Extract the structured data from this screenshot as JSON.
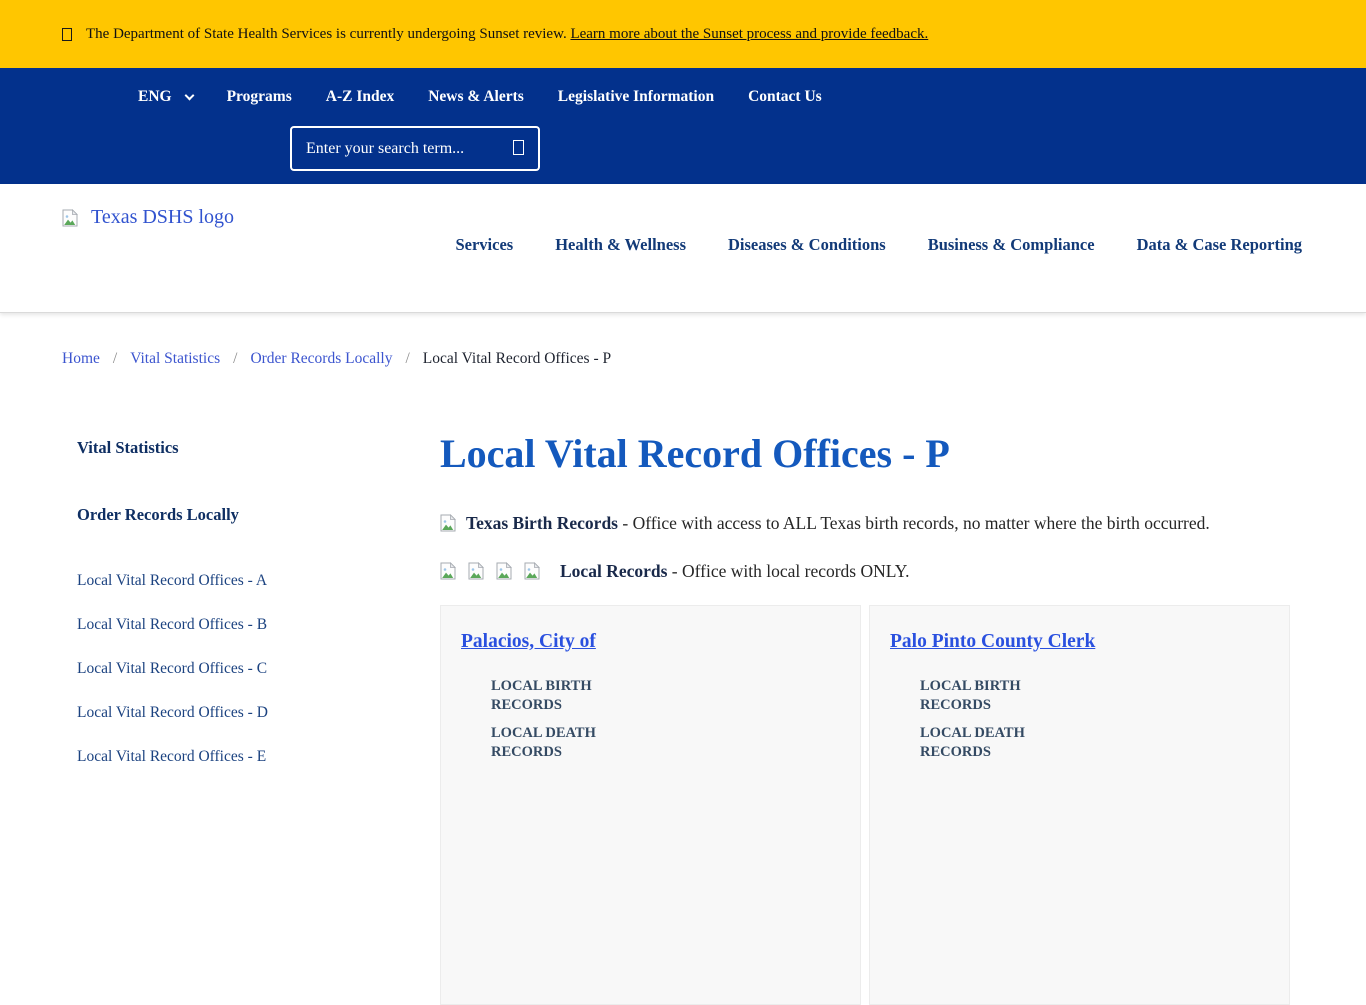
{
  "banner": {
    "text": "The Department of State Health Services is currently undergoing Sunset review.",
    "link_text": "Learn more about the Sunset process and provide feedback."
  },
  "utility_nav": {
    "language": "ENG",
    "items": [
      {
        "label": "Programs"
      },
      {
        "label": "A-Z Index"
      },
      {
        "label": "News & Alerts"
      },
      {
        "label": "Legislative Information"
      },
      {
        "label": "Contact Us"
      }
    ]
  },
  "search": {
    "placeholder": "Enter your search term..."
  },
  "header": {
    "logo_alt": "Texas DSHS logo",
    "nav": [
      {
        "label": "Services"
      },
      {
        "label": "Health & Wellness"
      },
      {
        "label": "Diseases & Conditions"
      },
      {
        "label": "Business & Compliance"
      },
      {
        "label": "Data & Case Reporting"
      }
    ]
  },
  "breadcrumb": {
    "separator": "/",
    "links": [
      {
        "label": "Home"
      },
      {
        "label": "Vital Statistics"
      },
      {
        "label": "Order Records Locally"
      }
    ],
    "current": "Local Vital Record Offices - P"
  },
  "sidebar": {
    "sections": [
      {
        "label": "Vital Statistics"
      },
      {
        "label": "Order Records Locally"
      }
    ],
    "items": [
      {
        "label": "Local Vital Record Offices - A"
      },
      {
        "label": "Local Vital Record Offices - B"
      },
      {
        "label": "Local Vital Record Offices - C"
      },
      {
        "label": "Local Vital Record Offices - D"
      },
      {
        "label": "Local Vital Record Offices - E"
      }
    ]
  },
  "main": {
    "title": "Local Vital Record Offices - P",
    "legend": [
      {
        "bold": "Texas Birth Records",
        "text": " - Office with access to ALL Texas birth records, no matter where the birth occurred."
      },
      {
        "bold": "Local Records",
        "text": " - Office with local records ONLY."
      }
    ],
    "offices": [
      {
        "name": "Palacios, City of",
        "records": [
          "LOCAL BIRTH RECORDS",
          "LOCAL DEATH RECORDS"
        ]
      },
      {
        "name": "Palo Pinto County Clerk",
        "records": [
          "LOCAL BIRTH RECORDS",
          "LOCAL DEATH RECORDS"
        ]
      }
    ]
  },
  "icons": {
    "warning_glyph": "missing-glyph-box",
    "search": "search-icon (missing-glyph-box)",
    "language_chevron": "chevron-down-icon",
    "broken_image": "broken-image-icon"
  },
  "colors": {
    "banner_bg": "#FFC600",
    "navbar_bg": "#03318C",
    "title_blue": "#1459bd",
    "link_blue": "#2a50df",
    "nav_navy": "#123a78",
    "card_bg": "#f8f8f8"
  }
}
